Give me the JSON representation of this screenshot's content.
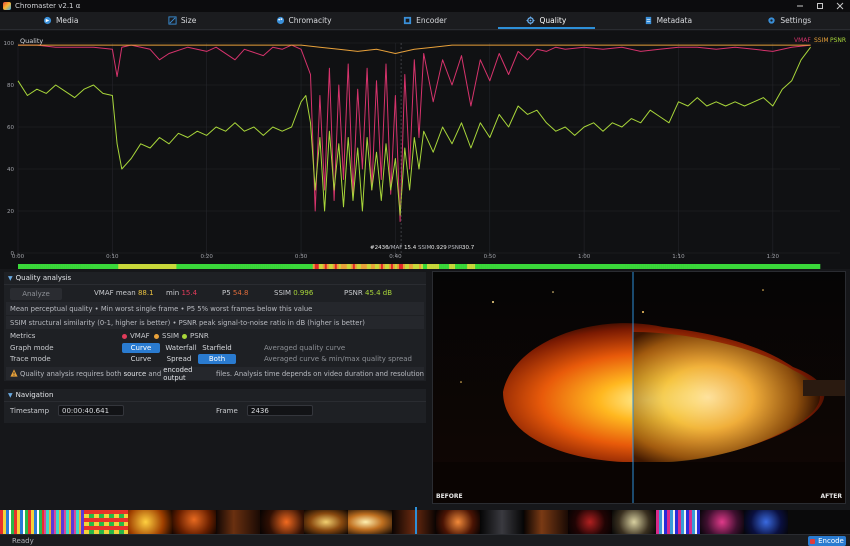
{
  "app": {
    "title": "Chromaster v2.1 α"
  },
  "tabs": [
    {
      "label": "Media",
      "icon": "media-icon",
      "active": false
    },
    {
      "label": "Size",
      "icon": "resize-icon",
      "active": false
    },
    {
      "label": "Chromacity",
      "icon": "palette-icon",
      "active": false
    },
    {
      "label": "Encoder",
      "icon": "encoder-icon",
      "active": false
    },
    {
      "label": "Quality",
      "icon": "gear-icon",
      "active": true
    },
    {
      "label": "Metadata",
      "icon": "document-icon",
      "active": false
    },
    {
      "label": "Settings",
      "icon": "settings-icon",
      "active": false
    }
  ],
  "chart_data": {
    "type": "line",
    "title": "Quality",
    "xlabel": "",
    "ylabel": "",
    "ylim": [
      0,
      100
    ],
    "yticks": [
      "0",
      "20",
      "40",
      "60",
      "80",
      "100"
    ],
    "xlim": [
      0,
      85
    ],
    "xticks": [
      {
        "t": 0,
        "label": "0:00"
      },
      {
        "t": 10,
        "label": "0:10"
      },
      {
        "t": 20,
        "label": "0:20"
      },
      {
        "t": 30,
        "label": "0:30"
      },
      {
        "t": 40,
        "label": "0:40"
      },
      {
        "t": 50,
        "label": "0:50"
      },
      {
        "t": 60,
        "label": "1:00"
      },
      {
        "t": 70,
        "label": "1:10"
      },
      {
        "t": 80,
        "label": "1:20"
      }
    ],
    "legend": [
      "VMAF",
      "SSIM",
      "PSNR"
    ],
    "legend_position": "top-right",
    "colors": {
      "VMAF": "#d6336c",
      "SSIM": "#e8a13a",
      "PSNR": "#a8d63a"
    },
    "cursor_label": {
      "frame": "#2436",
      "vmaf_label": "VMAF",
      "vmaf": "15.4",
      "ssim_label": "SSIM",
      "ssim": "0.929",
      "psnr_label": "PSNR",
      "psnr": "30.7"
    },
    "series": [
      {
        "name": "VMAF",
        "points": [
          [
            0,
            99
          ],
          [
            2,
            99
          ],
          [
            4,
            98
          ],
          [
            6,
            98
          ],
          [
            8,
            98
          ],
          [
            10,
            97
          ],
          [
            10.5,
            84
          ],
          [
            11,
            98
          ],
          [
            12,
            99
          ],
          [
            14,
            97
          ],
          [
            15,
            92
          ],
          [
            16,
            95
          ],
          [
            18,
            98
          ],
          [
            20,
            96
          ],
          [
            21,
            98
          ],
          [
            23,
            92
          ],
          [
            24,
            97
          ],
          [
            26,
            94
          ],
          [
            27,
            98
          ],
          [
            28,
            97
          ],
          [
            29,
            99
          ],
          [
            30,
            97
          ],
          [
            31,
            85
          ],
          [
            31.5,
            20
          ],
          [
            32,
            75
          ],
          [
            32.5,
            30
          ],
          [
            33,
            88
          ],
          [
            33.5,
            25
          ],
          [
            34,
            80
          ],
          [
            34.5,
            35
          ],
          [
            35,
            90
          ],
          [
            35.5,
            28
          ],
          [
            36,
            78
          ],
          [
            36.5,
            40
          ],
          [
            37,
            88
          ],
          [
            37.5,
            30
          ],
          [
            38,
            82
          ],
          [
            38.5,
            35
          ],
          [
            39,
            90
          ],
          [
            39.5,
            28
          ],
          [
            40,
            75
          ],
          [
            40.5,
            15
          ],
          [
            41,
            85
          ],
          [
            41.5,
            40
          ],
          [
            42,
            92
          ],
          [
            42.5,
            55
          ],
          [
            43,
            95
          ],
          [
            44,
            72
          ],
          [
            45,
            92
          ],
          [
            46,
            80
          ],
          [
            47,
            94
          ],
          [
            48,
            70
          ],
          [
            49,
            92
          ],
          [
            50,
            82
          ],
          [
            51,
            95
          ],
          [
            52,
            85
          ],
          [
            53,
            96
          ],
          [
            54,
            92
          ],
          [
            55,
            97
          ],
          [
            56,
            96
          ],
          [
            57,
            98
          ],
          [
            58,
            97
          ],
          [
            60,
            98
          ],
          [
            62,
            97
          ],
          [
            64,
            98
          ],
          [
            66,
            96
          ],
          [
            68,
            97
          ],
          [
            70,
            98
          ],
          [
            72,
            98
          ],
          [
            74,
            97
          ],
          [
            76,
            98
          ],
          [
            78,
            97
          ],
          [
            80,
            96
          ],
          [
            82,
            98
          ],
          [
            84,
            99
          ]
        ]
      },
      {
        "name": "SSIM",
        "points": [
          [
            0,
            99
          ],
          [
            10,
            99
          ],
          [
            20,
            99
          ],
          [
            30,
            99
          ],
          [
            32,
            98
          ],
          [
            34,
            97
          ],
          [
            36,
            96
          ],
          [
            38,
            97
          ],
          [
            40,
            95
          ],
          [
            42,
            97
          ],
          [
            44,
            98
          ],
          [
            46,
            99
          ],
          [
            50,
            99
          ],
          [
            60,
            99
          ],
          [
            70,
            99
          ],
          [
            80,
            99
          ],
          [
            84,
            99
          ]
        ]
      },
      {
        "name": "PSNR",
        "points": [
          [
            0,
            82
          ],
          [
            1,
            75
          ],
          [
            2,
            78
          ],
          [
            3,
            76
          ],
          [
            4,
            80
          ],
          [
            5,
            77
          ],
          [
            6,
            74
          ],
          [
            7,
            78
          ],
          [
            8,
            80
          ],
          [
            9,
            76
          ],
          [
            10,
            75
          ],
          [
            10.5,
            52
          ],
          [
            11,
            40
          ],
          [
            12,
            45
          ],
          [
            13,
            52
          ],
          [
            14,
            50
          ],
          [
            15,
            55
          ],
          [
            16,
            52
          ],
          [
            17,
            57
          ],
          [
            18,
            55
          ],
          [
            19,
            58
          ],
          [
            20,
            56
          ],
          [
            21,
            60
          ],
          [
            22,
            58
          ],
          [
            23,
            62
          ],
          [
            24,
            58
          ],
          [
            25,
            60
          ],
          [
            26,
            56
          ],
          [
            27,
            60
          ],
          [
            28,
            58
          ],
          [
            29,
            60
          ],
          [
            30,
            72
          ],
          [
            30.5,
            75
          ],
          [
            31,
            62
          ],
          [
            31.5,
            30
          ],
          [
            32,
            55
          ],
          [
            32.5,
            20
          ],
          [
            33,
            58
          ],
          [
            33.5,
            30
          ],
          [
            34,
            52
          ],
          [
            34.5,
            22
          ],
          [
            35,
            55
          ],
          [
            35.5,
            25
          ],
          [
            36,
            50
          ],
          [
            36.5,
            20
          ],
          [
            37,
            55
          ],
          [
            37.5,
            30
          ],
          [
            38,
            48
          ],
          [
            38.5,
            25
          ],
          [
            39,
            52
          ],
          [
            39.5,
            30
          ],
          [
            40,
            45
          ],
          [
            40.5,
            18
          ],
          [
            41,
            50
          ],
          [
            41.5,
            30
          ],
          [
            42,
            55
          ],
          [
            42.5,
            40
          ],
          [
            43,
            58
          ],
          [
            44,
            48
          ],
          [
            45,
            60
          ],
          [
            46,
            52
          ],
          [
            47,
            62
          ],
          [
            48,
            50
          ],
          [
            49,
            62
          ],
          [
            50,
            55
          ],
          [
            51,
            66
          ],
          [
            52,
            60
          ],
          [
            53,
            70
          ],
          [
            54,
            66
          ],
          [
            55,
            68
          ],
          [
            56,
            62
          ],
          [
            57,
            58
          ],
          [
            58,
            60
          ],
          [
            59,
            56
          ],
          [
            60,
            60
          ],
          [
            61,
            62
          ],
          [
            62,
            58
          ],
          [
            63,
            62
          ],
          [
            64,
            60
          ],
          [
            65,
            64
          ],
          [
            66,
            62
          ],
          [
            67,
            68
          ],
          [
            68,
            65
          ],
          [
            69,
            62
          ],
          [
            70,
            72
          ],
          [
            71,
            70
          ],
          [
            72,
            74
          ],
          [
            73,
            70
          ],
          [
            74,
            72
          ],
          [
            75,
            70
          ],
          [
            76,
            72
          ],
          [
            77,
            70
          ],
          [
            78,
            72
          ],
          [
            79,
            74
          ],
          [
            80,
            70
          ],
          [
            81,
            78
          ],
          [
            82,
            82
          ],
          [
            83,
            92
          ],
          [
            84,
            98
          ]
        ]
      }
    ]
  },
  "quality_panel": {
    "heading": "Quality analysis",
    "analyze_label": "Analyze",
    "vmaf_mean_label": "VMAF mean",
    "vmaf_mean": "88.1",
    "min_label": "min",
    "min_value": "15.4",
    "p5_label": "P5",
    "p5_value": "54.8",
    "ssim_label": "SSIM",
    "ssim_value": "0.996",
    "psnr_label": "PSNR",
    "psnr_value": "45.4 dB",
    "info1": "Mean perceptual quality • Min worst single frame • P5 5% worst frames below this value",
    "info2": "SSIM structural similarity (0-1, higher is better) • PSNR peak signal-to-noise ratio in dB (higher is better)",
    "metrics_label": "Metrics",
    "metrics": [
      {
        "label": "VMAF",
        "color": "#e03b5a"
      },
      {
        "label": "SSIM",
        "color": "#e8a13a"
      },
      {
        "label": "PSNR",
        "color": "#a8d63a"
      }
    ],
    "graph_mode_label": "Graph mode",
    "graph_modes": [
      "Curve",
      "Waterfall",
      "Starfield"
    ],
    "graph_mode_desc": "Averaged quality curve",
    "trace_mode_label": "Trace mode",
    "trace_modes": [
      "Curve",
      "Spread",
      "Both"
    ],
    "trace_mode_desc": "Averaged curve & min/max quality spread",
    "warning_prefix": "Quality analysis requires both ",
    "warning_source": "source",
    "warning_and": " and ",
    "warning_encoded": "encoded output",
    "warning_suffix": " files. Analysis time depends on video duration and resolution",
    "warning_color": "#e8a13a"
  },
  "navigation": {
    "heading": "Navigation",
    "timestamp_label": "Timestamp",
    "timestamp_value": "00:00:40.641",
    "frame_label": "Frame",
    "frame_value": "2436"
  },
  "preview": {
    "before_label": "BEFORE",
    "after_label": "AFTER"
  },
  "status": {
    "text": "Ready",
    "encode_label": "Encode"
  }
}
